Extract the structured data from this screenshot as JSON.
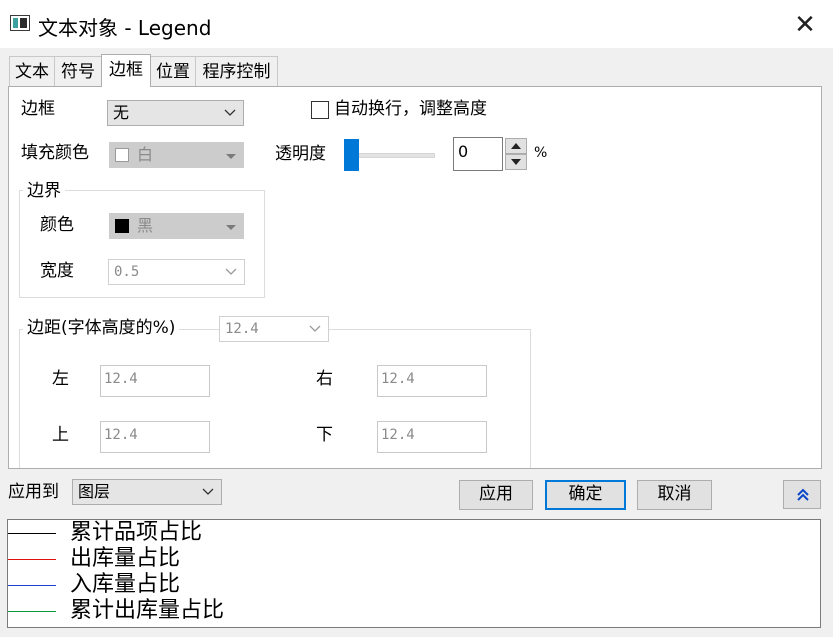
{
  "window": {
    "title": "文本对象 - Legend",
    "app_icon": "origin-window-icon",
    "close_icon": "close-icon"
  },
  "tabs": [
    {
      "label": "文本",
      "active": false
    },
    {
      "label": "符号",
      "active": false
    },
    {
      "label": "边框",
      "active": true
    },
    {
      "label": "位置",
      "active": false
    },
    {
      "label": "程序控制",
      "active": false
    }
  ],
  "border": {
    "label": "边框",
    "value": "无"
  },
  "auto_wrap": {
    "label": "自动换行，调整高度",
    "checked": false
  },
  "fill": {
    "label": "填充颜色",
    "value": "白",
    "swatch_color": "#ffffff"
  },
  "transparency": {
    "label": "透明度",
    "value": "0",
    "unit": "%"
  },
  "bounds": {
    "legend": "边界",
    "color_label": "颜色",
    "color_value": "黑",
    "color_swatch": "#000000",
    "width_label": "宽度",
    "width_value": "0.5"
  },
  "margins": {
    "legend": "边距(字体高度的%)",
    "combo_value": "12.4",
    "left_label": "左",
    "left_value": "12.4",
    "right_label": "右",
    "right_value": "12.4",
    "top_label": "上",
    "top_value": "12.4",
    "bottom_label": "下",
    "bottom_value": "12.4"
  },
  "apply_to": {
    "label": "应用到",
    "value": "图层"
  },
  "buttons": {
    "apply": "应用",
    "ok": "确定",
    "cancel": "取消",
    "expand_icon": "double-chevron-up-icon"
  },
  "preview": {
    "items": [
      {
        "label": "累计品项占比",
        "color": "#000000"
      },
      {
        "label": "出库量占比",
        "color": "#e01010"
      },
      {
        "label": "入库量占比",
        "color": "#1a3fd6"
      },
      {
        "label": "累计出库量占比",
        "color": "#0a9a3a"
      }
    ]
  }
}
